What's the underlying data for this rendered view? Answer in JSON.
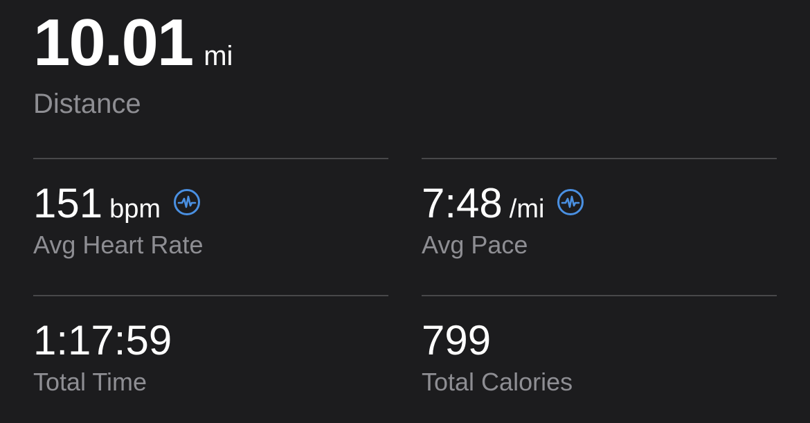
{
  "distance": {
    "value": "10.01",
    "unit": "mi",
    "label": "Distance"
  },
  "heart_rate": {
    "value": "151",
    "unit": "bpm",
    "label": "Avg Heart Rate",
    "icon": "heart-rate-sensor-icon"
  },
  "pace": {
    "value": "7:48",
    "unit": "/mi",
    "label": "Avg Pace",
    "icon": "heart-rate-sensor-icon"
  },
  "total_time": {
    "value": "1:17:59",
    "label": "Total Time"
  },
  "calories": {
    "value": "799",
    "label": "Total Calories"
  },
  "colors": {
    "background": "#1c1c1e",
    "value_text": "#ffffff",
    "label_text": "#8e8e93",
    "divider": "#48484a",
    "icon_accent": "#4a90e2"
  }
}
